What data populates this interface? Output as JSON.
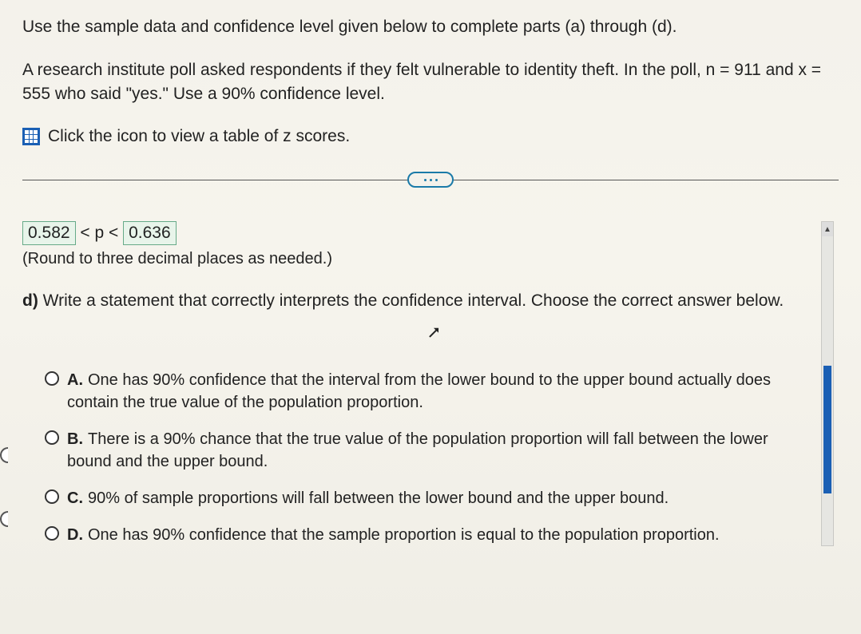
{
  "intro": "Use the sample data and confidence level given below to complete parts (a) through (d).",
  "scenario": "A research institute poll asked respondents if they felt vulnerable to identity theft. In the poll, n = 911 and x = 555 who said \"yes.\" Use a 90% confidence level.",
  "z_link": "Click the icon to view a table of z scores.",
  "ci": {
    "lower": "0.582",
    "middle": " < p < ",
    "upper": "0.636"
  },
  "round_note": "(Round to three decimal places as needed.)",
  "part_d": {
    "label": "d)",
    "text": " Write a statement that correctly interprets the confidence interval. Choose the correct answer below."
  },
  "options": {
    "a": {
      "letter": "A.",
      "text": "One has 90% confidence that the interval from the lower bound to the upper bound actually does contain the true value of the population proportion."
    },
    "b": {
      "letter": "B.",
      "text": "There is a 90% chance that the true value of the population proportion will fall between the lower bound and the upper bound."
    },
    "c": {
      "letter": "C.",
      "text": "90% of sample proportions will fall between the lower bound and the upper bound."
    },
    "d": {
      "letter": "D.",
      "text": "One has 90% confidence that the sample proportion is equal to the population proportion."
    }
  }
}
